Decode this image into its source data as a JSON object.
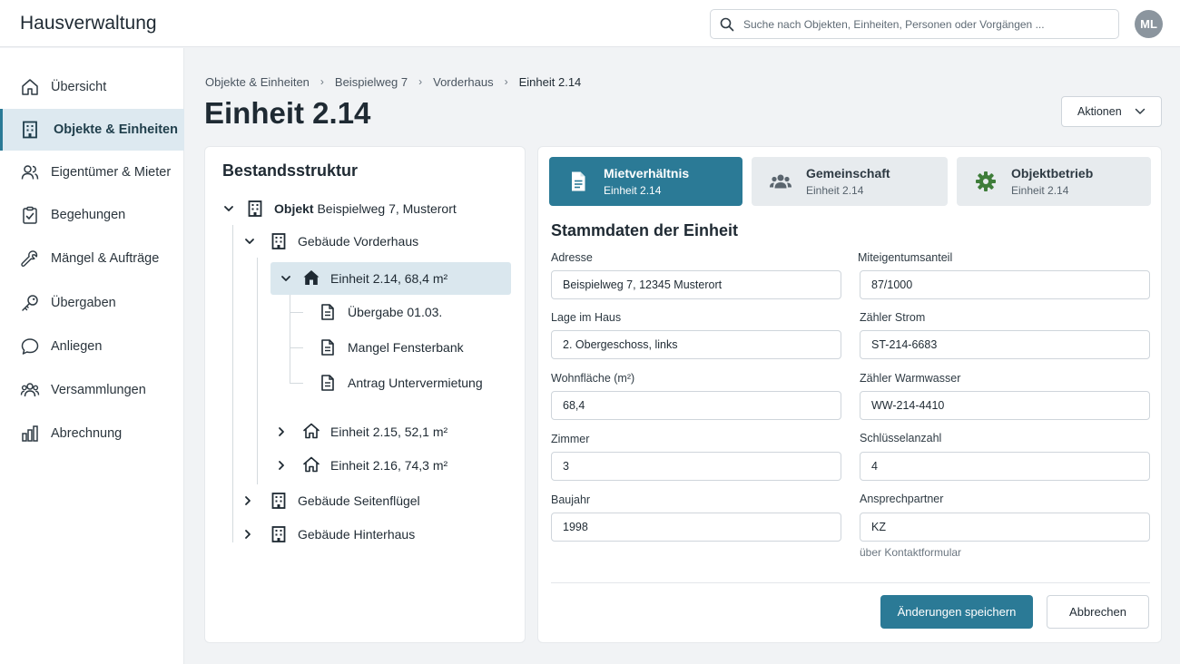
{
  "app": {
    "title": "Hausverwaltung"
  },
  "header": {
    "search_placeholder": "Suche nach Objekten, Einheiten, Personen oder Vorgängen ...",
    "search_value": "",
    "avatar_initials": "ML"
  },
  "sidebar": {
    "items": [
      {
        "label": "Übersicht",
        "icon": "home-icon",
        "active": false
      },
      {
        "label": "Objekte & Einheiten",
        "icon": "building-icon",
        "active": true
      },
      {
        "label": "Eigentümer & Mieter",
        "icon": "users-icon",
        "active": false
      },
      {
        "label": "Begehungen",
        "icon": "clipboard-check-icon",
        "active": false
      },
      {
        "label": "Mängel & Aufträge",
        "icon": "wrench-icon",
        "active": false
      },
      {
        "label": "Übergaben",
        "icon": "key-icon",
        "active": false
      },
      {
        "label": "Anliegen",
        "icon": "chat-bubble-icon",
        "active": false
      },
      {
        "label": "Versammlungen",
        "icon": "group-icon",
        "active": false
      },
      {
        "label": "Abrechnung",
        "icon": "bar-chart-icon",
        "active": false
      }
    ]
  },
  "breadcrumb": {
    "items": [
      "Objekte & Einheiten",
      "Beispielweg 7",
      "Vorderhaus",
      "Einheit 2.14"
    ]
  },
  "page": {
    "title": "Einheit 2.14",
    "actions_label": "Aktionen"
  },
  "tree": {
    "title": "Bestandsstruktur",
    "root": {
      "prefix": "Objekt",
      "label": "Beispielweg 7, Musterort"
    },
    "building1": {
      "label": "Gebäude Vorderhaus"
    },
    "unit_selected": {
      "label": "Einheit 2.14, 68,4 m²"
    },
    "docs": [
      "Übergabe 01.03.",
      "Mangel Fensterbank",
      "Antrag Untervermietung"
    ],
    "unit2": {
      "label": "Einheit 2.15, 52,1 m²"
    },
    "unit3": {
      "label": "Einheit 2.16, 74,3 m²"
    },
    "building2": {
      "label": "Gebäude Seitenflügel"
    },
    "building3": {
      "label": "Gebäude Hinterhaus"
    }
  },
  "tabs": [
    {
      "name": "Mietverhältnis",
      "sub": "Einheit 2.14",
      "icon": "document-icon",
      "active": true
    },
    {
      "name": "Gemeinschaft",
      "sub": "Einheit 2.14",
      "icon": "group-icon",
      "active": false
    },
    {
      "name": "Objektbetrieb",
      "sub": "Einheit 2.14",
      "icon": "gear-icon",
      "active": false
    }
  ],
  "form": {
    "title": "Stammdaten der Einheit",
    "left": [
      {
        "label": "Adresse",
        "value": "Beispielweg 7, 12345 Musterort"
      },
      {
        "label": "Lage im Haus",
        "value": "2. Obergeschoss, links"
      },
      {
        "label": "Wohnfläche (m²)",
        "value": "68,4"
      },
      {
        "label": "Zimmer",
        "value": "3"
      },
      {
        "label": "Baujahr",
        "value": "1998"
      }
    ],
    "right": [
      {
        "label": "Miteigentumsanteil",
        "value": "87/1000"
      },
      {
        "label": "Zähler Strom",
        "value": "ST-214-6683"
      },
      {
        "label": "Zähler Warmwasser",
        "value": "WW-214-4410"
      },
      {
        "label": "Schlüsselanzahl",
        "value": "4"
      },
      {
        "label": "Ansprechpartner",
        "value": "KZ"
      }
    ],
    "contact_hint": "über Kontaktformular",
    "save_label": "Änderungen speichern",
    "cancel_label": "Abbrechen"
  },
  "colors": {
    "accent": "#2b7a96",
    "active_nav_bg": "#dde9f0",
    "tree_selected_bg": "#dae7ee",
    "inactive_tab_bg": "#e7ebee"
  }
}
